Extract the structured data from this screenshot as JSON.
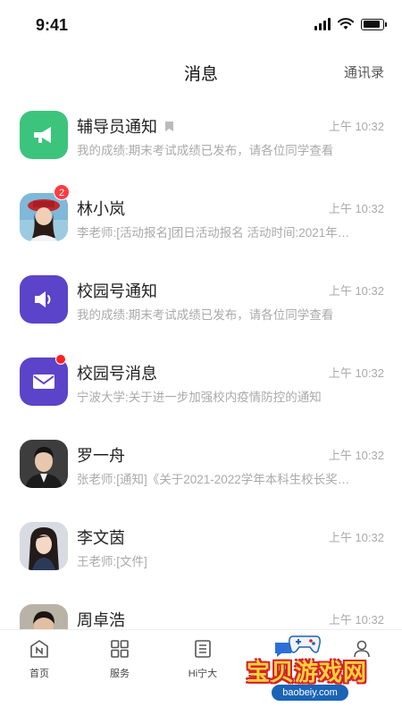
{
  "status_bar": {
    "time": "9:41",
    "battery_level": 0.9
  },
  "header": {
    "title": "消息",
    "contacts_link": "通讯录"
  },
  "messages": [
    {
      "name": "辅导员通知",
      "preview": "我的成绩:期末考试成绩已发布，请各位同学查看",
      "time": "上午 10:32",
      "avatar_icon": "megaphone-icon",
      "avatar_color": "#3cc47c",
      "flag_icon": "bookmark-icon"
    },
    {
      "name": "林小岚",
      "preview": "李老师:[活动报名]团日活动报名 活动时间:2021年…",
      "time": "上午 10:32",
      "avatar_icon": "user-photo",
      "badge_count": "2"
    },
    {
      "name": "校园号通知",
      "preview": "我的成绩:期末考试成绩已发布，请各位同学查看",
      "time": "上午 10:32",
      "avatar_icon": "speaker-icon",
      "avatar_color": "#5b44c9"
    },
    {
      "name": "校园号消息",
      "preview": "宁波大学:关于进一步加强校内疫情防控的通知",
      "time": "上午 10:32",
      "avatar_icon": "envelope-icon",
      "avatar_color": "#5b44c9",
      "unread_dot": true
    },
    {
      "name": "罗一舟",
      "preview": "张老师:[通知]《关于2021-2022学年本科生校长奖…",
      "time": "上午 10:32",
      "avatar_icon": "user-photo"
    },
    {
      "name": "李文茵",
      "preview": "王老师:[文件]",
      "time": "上午 10:32",
      "avatar_icon": "user-photo"
    },
    {
      "name": "周卓浩",
      "preview": "",
      "time": "上午 10:32",
      "avatar_icon": "user-photo"
    }
  ],
  "tabs": [
    {
      "label": "首页",
      "icon": "home-icon"
    },
    {
      "label": "服务",
      "icon": "grid-icon"
    },
    {
      "label": "Hi宁大",
      "icon": "document-icon"
    },
    {
      "label": "消息",
      "icon": "message-icon"
    },
    {
      "label": "",
      "icon": "profile-icon"
    }
  ],
  "watermark": {
    "text": "宝贝游戏网",
    "url": "baobeiy.com"
  },
  "colors": {
    "accent_green": "#3cc47c",
    "accent_purple": "#5b44c9",
    "badge_red": "#ff3b42",
    "text_secondary": "#aaaaaa"
  }
}
